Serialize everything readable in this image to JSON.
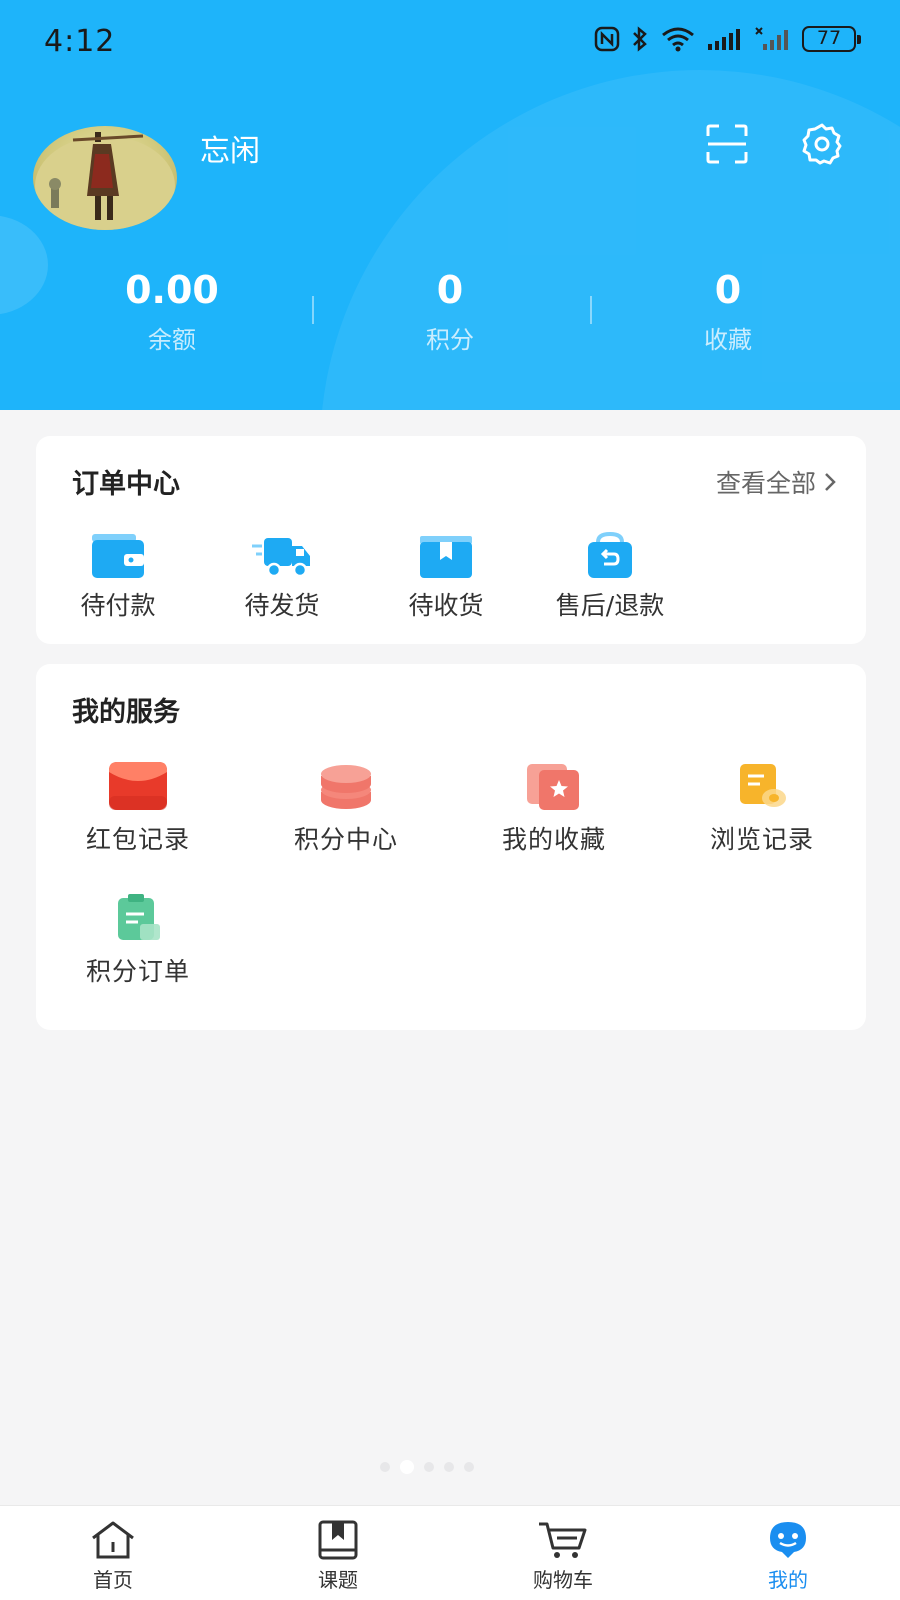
{
  "status_bar": {
    "time": "4:12",
    "battery": "77"
  },
  "profile": {
    "username": "忘闲"
  },
  "stats": [
    {
      "value": "0.00",
      "label": "余额"
    },
    {
      "value": "0",
      "label": "积分"
    },
    {
      "value": "0",
      "label": "收藏"
    }
  ],
  "orders": {
    "title": "订单中心",
    "view_all": "查看全部",
    "items": [
      {
        "label": "待付款",
        "icon": "wallet-icon"
      },
      {
        "label": "待发货",
        "icon": "truck-icon"
      },
      {
        "label": "待收货",
        "icon": "package-icon"
      },
      {
        "label": "售后/退款",
        "icon": "refund-bag-icon"
      }
    ]
  },
  "services": {
    "title": "我的服务",
    "items": [
      {
        "label": "红包记录",
        "icon": "red-envelope-icon"
      },
      {
        "label": "积分中心",
        "icon": "coin-stack-icon"
      },
      {
        "label": "我的收藏",
        "icon": "favorite-card-icon"
      },
      {
        "label": "浏览记录",
        "icon": "history-note-icon"
      },
      {
        "label": "积分订单",
        "icon": "clipboard-icon"
      }
    ]
  },
  "tabbar": {
    "items": [
      {
        "label": "首页",
        "icon": "home-icon"
      },
      {
        "label": "课题",
        "icon": "book-icon"
      },
      {
        "label": "购物车",
        "icon": "cart-icon"
      },
      {
        "label": "我的",
        "icon": "profile-mascot-icon",
        "active": true
      }
    ]
  },
  "colors": {
    "header_bg": "#1eb4fa",
    "accent": "#1a8ef0",
    "page_bg": "#f5f5f6"
  }
}
